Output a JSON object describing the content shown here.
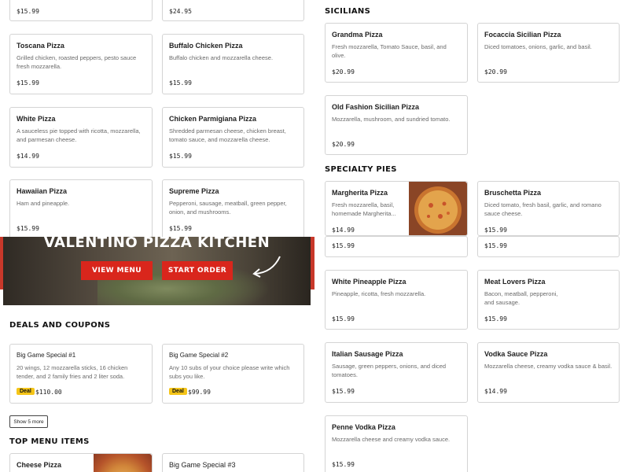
{
  "left_column": {
    "top_prices": [
      "$15.99",
      "$24.95"
    ],
    "items": [
      {
        "name": "Toscana Pizza",
        "desc": "Grilled chicken, roasted peppers, pesto sauce fresh mozzarella.",
        "price": "$15.99"
      },
      {
        "name": "Buffalo Chicken Pizza",
        "desc": "Buffalo chicken and mozzarella cheese.",
        "price": "$15.99"
      },
      {
        "name": "White Pizza",
        "desc": "A sauceless pie topped with ricotta, mozzarella, and parmesan cheese.",
        "price": "$14.99"
      },
      {
        "name": "Chicken Parmigiana Pizza",
        "desc": "Shredded parmesan cheese, chicken breast, tomato sauce, and mozzarella cheese.",
        "price": "$15.99"
      },
      {
        "name": "Hawaiian Pizza",
        "desc": "Ham and pineapple.",
        "price": "$15.99"
      },
      {
        "name": "Supreme Pizza",
        "desc": "Pepperoni, sausage, meatball, green pepper, onion, and mushrooms.",
        "price": "$15.99"
      }
    ]
  },
  "hero": {
    "title": "VALENTINO PIZZA KITCHEN",
    "view_menu": "VIEW MENU",
    "start_order": "START ORDER"
  },
  "deals": {
    "title": "DEALS AND COUPONS",
    "items": [
      {
        "name": "Big Game Special #1",
        "desc": "20 wings, 12 mozzarella sticks, 16 chicken tender, and 2 family fries and 2 liter soda.",
        "badge": "Deal",
        "price": "$110.00"
      },
      {
        "name": "Big Game Special #2",
        "desc": "Any 10 subs of your choice please write which subs you like.",
        "badge": "Deal",
        "price": "$99.99"
      }
    ],
    "show_more": "Show 5 more"
  },
  "top_menu": {
    "title": "TOP MENU ITEMS",
    "items": [
      {
        "name": "Cheese Pizza"
      },
      {
        "name": "Big Game Special #3"
      }
    ]
  },
  "sicilians": {
    "title": "SICILIANS",
    "items": [
      {
        "name": "Grandma Pizza",
        "desc": "Fresh mozzarella, Tomato Sauce, basil, and olive.",
        "price": "$20.99"
      },
      {
        "name": "Focaccia Sicilian Pizza",
        "desc": "Diced tomatoes, onions, garlic, and basil.",
        "price": "$20.99"
      },
      {
        "name": "Old Fashion Sicilian Pizza",
        "desc": "Mozzarella, mushroom, and sundried tomato.",
        "price": "$20.99"
      }
    ]
  },
  "specialty": {
    "title": "SPECIALTY PIES",
    "items": [
      {
        "name": "Margherita Pizza",
        "desc": "Fresh mozzarella, basil, homemade Margherita...",
        "price": "$14.99"
      },
      {
        "name": "Bruschetta Pizza",
        "desc": "Diced tomato, fresh basil, garlic, and romano sauce cheese.",
        "price": "$15.99"
      },
      {
        "name": "White Pineapple Pizza",
        "desc": "Pineapple, ricotta, fresh mozzarella.",
        "price": "$15.99"
      },
      {
        "name": "Meat Lovers Pizza",
        "desc": "Bacon, meatball, pepperoni, and sausage.",
        "price": "$15.99"
      },
      {
        "name": "Italian Sausage Pizza",
        "desc": "Sausage, green peppers, onions, and diced tomatoes.",
        "price": "$15.99"
      },
      {
        "name": "Vodka Sauce Pizza",
        "desc": "Mozzarella cheese, creamy vodka sauce & basil.",
        "price": "$14.99"
      },
      {
        "name": "Penne Vodka Pizza",
        "desc": "Mozzarella cheese and creamy vodka sauce.",
        "price": "$15.99"
      }
    ],
    "stray_prices": [
      "$15.99",
      "$15.99"
    ]
  },
  "colors": {
    "accent": "#d9261c",
    "badge": "#f5c518",
    "border": "#d4d4d4"
  }
}
